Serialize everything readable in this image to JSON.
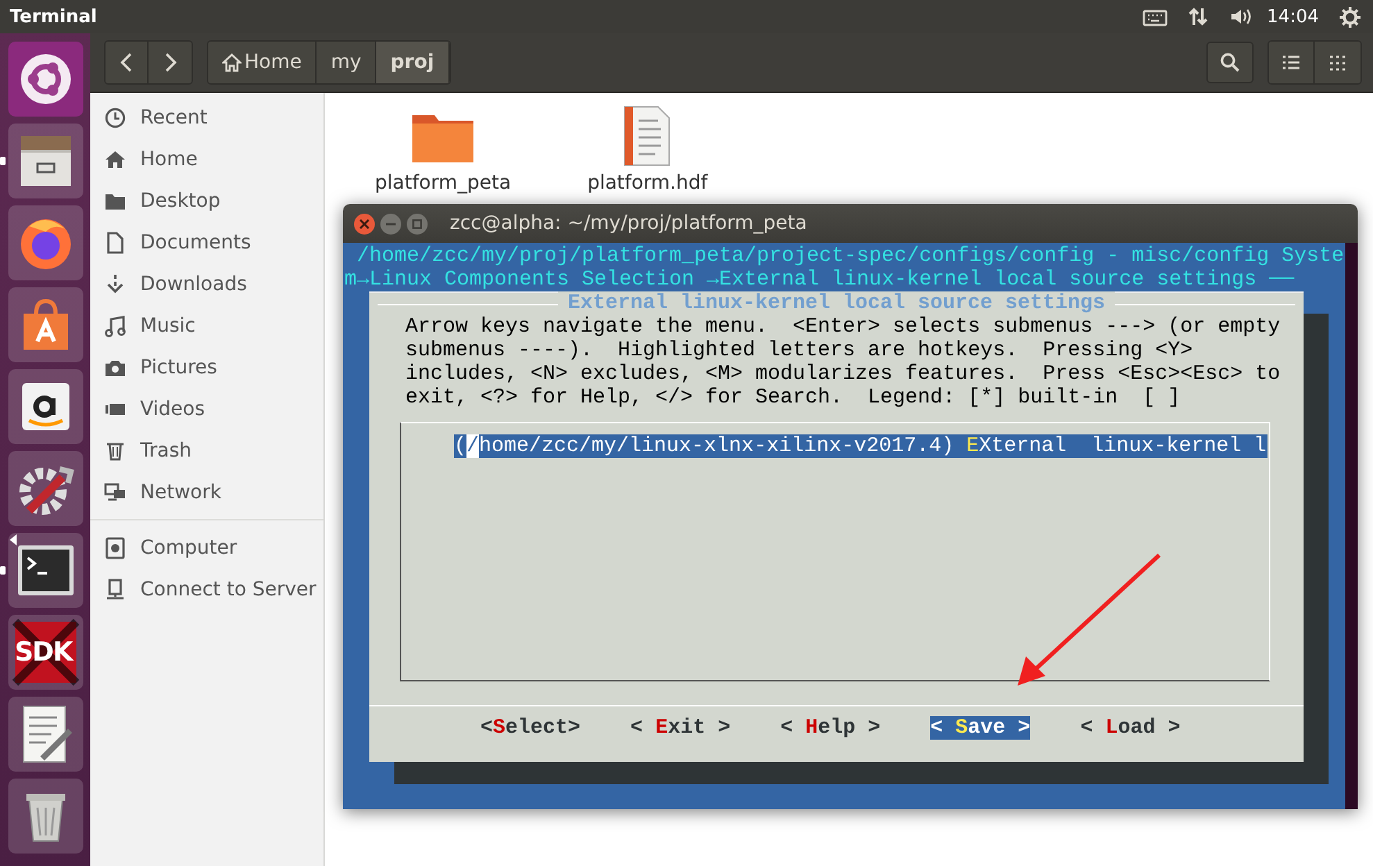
{
  "top_panel": {
    "title": "Terminal",
    "clock": "14:04"
  },
  "launcher": {
    "items": [
      {
        "kind": "ubuntu",
        "running": false,
        "focused": false
      },
      {
        "kind": "files",
        "running": true,
        "focused": false
      },
      {
        "kind": "browser",
        "running": false,
        "focused": false
      },
      {
        "kind": "software",
        "running": false,
        "focused": false
      },
      {
        "kind": "amazon",
        "running": false,
        "focused": false
      },
      {
        "kind": "settings",
        "running": false,
        "focused": false
      },
      {
        "kind": "terminal",
        "running": true,
        "focused": true
      },
      {
        "kind": "sdk",
        "label": "SDK",
        "running": false,
        "focused": false
      },
      {
        "kind": "editor",
        "running": false,
        "focused": false
      },
      {
        "kind": "trash",
        "running": false,
        "focused": false
      }
    ]
  },
  "files": {
    "path": [
      {
        "label": "Home",
        "kind": "home",
        "selected": false
      },
      {
        "label": "my",
        "kind": "folder",
        "selected": false
      },
      {
        "label": "proj",
        "kind": "folder",
        "selected": true
      }
    ],
    "sidebar": {
      "places": [
        {
          "label": "Recent",
          "kind": "recent"
        },
        {
          "label": "Home",
          "kind": "home"
        },
        {
          "label": "Desktop",
          "kind": "desktop"
        },
        {
          "label": "Documents",
          "kind": "documents"
        },
        {
          "label": "Downloads",
          "kind": "downloads"
        },
        {
          "label": "Music",
          "kind": "music"
        },
        {
          "label": "Pictures",
          "kind": "pictures"
        },
        {
          "label": "Videos",
          "kind": "videos"
        },
        {
          "label": "Trash",
          "kind": "trash"
        },
        {
          "label": "Network",
          "kind": "network"
        }
      ],
      "devices": [
        {
          "label": "Computer",
          "kind": "computer"
        },
        {
          "label": "Connect to Server",
          "kind": "server"
        }
      ]
    },
    "items": [
      {
        "name": "platform_peta",
        "kind": "folder"
      },
      {
        "name": "platform.hdf",
        "kind": "document"
      }
    ]
  },
  "terminal": {
    "title": "zcc@alpha: ~/my/proj/platform_peta",
    "header_lines": [
      "/home/zcc/my/proj/platform_peta/project-spec/configs/config - misc/config Syste",
      "m→Linux Components Selection →External linux-kernel local source settings ──"
    ],
    "dialog": {
      "title": "External linux-kernel local source settings",
      "help_lines": [
        "Arrow keys navigate the menu.  <Enter> selects submenus ---> (or empty",
        "submenus ----).  Highlighted letters are hotkeys.  Pressing <Y>",
        "includes, <N> excludes, <M> modularizes features.  Press <Esc><Esc> to",
        "exit, <?> for Help, </> for Search.  Legend: [*] built-in  [ ]"
      ],
      "items": [
        {
          "prefix": "(",
          "cursor": "/",
          "value": "home/zcc/my/linux-xlnx-xilinx-v2017.4)",
          "hotkey": "E",
          "rest": "Xternal  linux-kernel l",
          "selected": true
        }
      ],
      "buttons": [
        {
          "before": "<",
          "hotkey": "S",
          "after": "elect>",
          "selected": false
        },
        {
          "before": "< ",
          "hotkey": "E",
          "after": "xit >",
          "selected": false
        },
        {
          "before": "< ",
          "hotkey": "H",
          "after": "elp >",
          "selected": false
        },
        {
          "before": "< ",
          "hotkey": "S",
          "after": "ave >",
          "selected": true
        },
        {
          "before": "< ",
          "hotkey": "L",
          "after": "oad >",
          "selected": false
        }
      ]
    }
  }
}
